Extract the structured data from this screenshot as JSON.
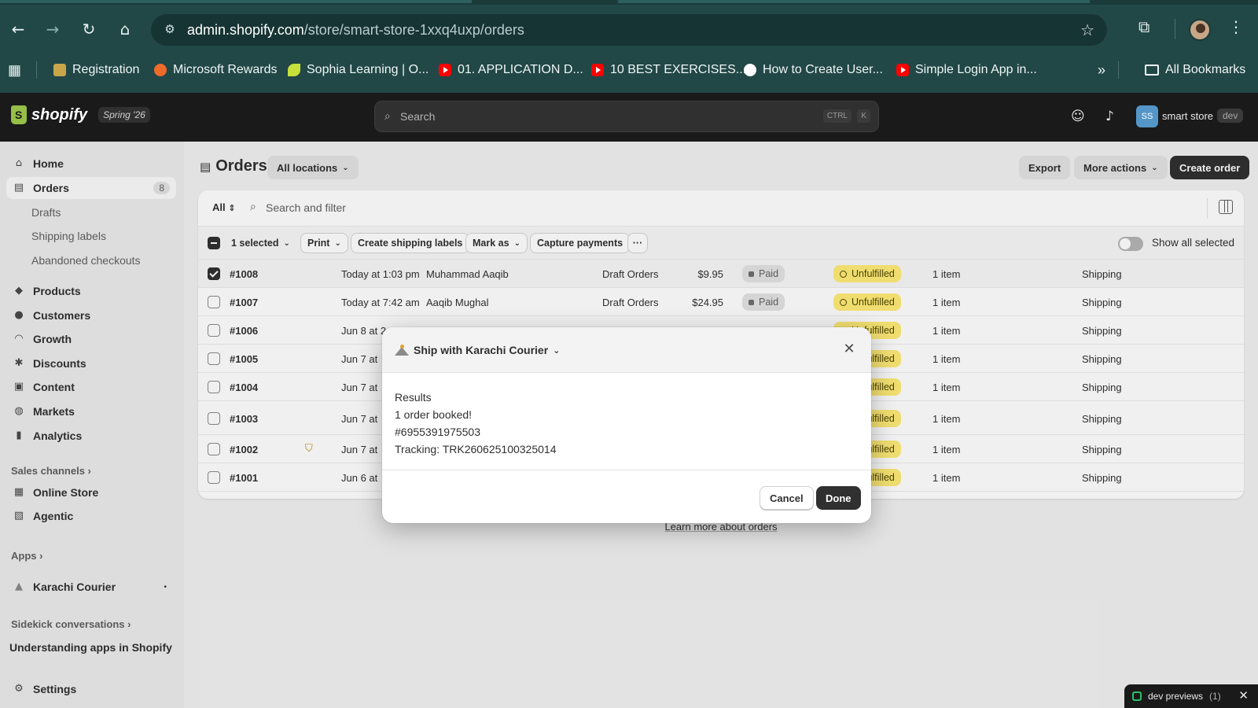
{
  "browser": {
    "url_host": "admin.shopify.com",
    "url_path": "/store/smart-store-1xxq4uxp/orders",
    "bookmarks": [
      {
        "label": "Registration",
        "icon": "registration-icon",
        "color": "#c9a64a"
      },
      {
        "label": "Microsoft Rewards",
        "icon": "rewards-icon",
        "color": "#f06a2a"
      },
      {
        "label": "Sophia Learning | O...",
        "icon": "sophia-icon",
        "color": "#c5e13a"
      },
      {
        "label": "01. APPLICATION D...",
        "icon": "youtube-icon",
        "color": "#ff0000"
      },
      {
        "label": "10 BEST EXERCISES...",
        "icon": "youtube-icon",
        "color": "#ff0000"
      },
      {
        "label": "How to Create User...",
        "icon": "medium-icon",
        "color": "#ffffff"
      },
      {
        "label": "Simple Login App in...",
        "icon": "youtube-icon",
        "color": "#ff0000"
      }
    ],
    "more_bookmarks": "»",
    "all_bookmarks": "All Bookmarks"
  },
  "topbar": {
    "brand": "shopify",
    "edition": "Spring '26",
    "search_placeholder": "Search",
    "shortcut_ctrl": "CTRL",
    "shortcut_k": "K",
    "store_initials": "SS",
    "store_name": "smart store",
    "env_badge": "dev"
  },
  "sidebar": {
    "home": "Home",
    "orders": "Orders",
    "orders_count": "8",
    "drafts": "Drafts",
    "shipping_labels": "Shipping labels",
    "abandoned_checkouts": "Abandoned checkouts",
    "products": "Products",
    "customers": "Customers",
    "growth": "Growth",
    "discounts": "Discounts",
    "content": "Content",
    "markets": "Markets",
    "analytics": "Analytics",
    "sales_channels": "Sales channels ›",
    "online_store": "Online Store",
    "agentic": "Agentic",
    "apps": "Apps ›",
    "karachi_courier": "Karachi Courier",
    "sidekick_conversations": "Sidekick conversations ›",
    "understanding_apps": "Understanding apps in Shopify",
    "settings": "Settings"
  },
  "page": {
    "title": "Orders",
    "locations": "All locations",
    "export": "Export",
    "more_actions": "More actions",
    "create_order": "Create order",
    "filter_all": "All",
    "search_filter": "Search and filter",
    "selected_count": "1 selected",
    "print": "Print",
    "create_shipping_labels": "Create shipping labels",
    "mark_as": "Mark as",
    "capture_payments": "Capture payments",
    "more": "···",
    "show_all_selected": "Show all selected",
    "learn_more": "Learn more about orders"
  },
  "orders": [
    {
      "id": "#1008",
      "date": "Today at 1:03 pm",
      "customer": "Muhammad Aaqib",
      "channel": "Draft Orders",
      "total": "$9.95",
      "payment": "Paid",
      "fulfillment": "Unfulfilled",
      "items": "1 item",
      "delivery": "Shipping",
      "checked": true
    },
    {
      "id": "#1007",
      "date": "Today at 7:42 am",
      "customer": "Aaqib Mughal",
      "channel": "Draft Orders",
      "total": "$24.95",
      "payment": "Paid",
      "fulfillment": "Unfulfilled",
      "items": "1 item",
      "delivery": "Shipping",
      "checked": false
    },
    {
      "id": "#1006",
      "date": "Jun 8 at 2",
      "customer": "",
      "channel": "",
      "total": "",
      "payment": "",
      "fulfillment": "Unfulfilled",
      "items": "1 item",
      "delivery": "Shipping",
      "checked": false
    },
    {
      "id": "#1005",
      "date": "Jun 7 at",
      "customer": "",
      "channel": "",
      "total": "",
      "payment": "",
      "fulfillment": "Unfulfilled",
      "items": "1 item",
      "delivery": "Shipping",
      "checked": false
    },
    {
      "id": "#1004",
      "date": "Jun 7 at",
      "customer": "",
      "channel": "",
      "total": "",
      "payment": "",
      "fulfillment": "Unfulfilled",
      "items": "1 item",
      "delivery": "Shipping",
      "checked": false
    },
    {
      "id": "#1003",
      "date": "Jun 7 at",
      "customer": "",
      "channel": "",
      "total": "",
      "payment": "",
      "fulfillment": "Unfulfilled",
      "items": "1 item",
      "delivery": "Shipping",
      "checked": false
    },
    {
      "id": "#1002",
      "date": "Jun 7 at",
      "customer": "",
      "channel": "",
      "total": "",
      "payment": "",
      "fulfillment": "Unfulfilled",
      "items": "1 item",
      "delivery": "Shipping",
      "checked": false
    },
    {
      "id": "#1001",
      "date": "Jun 6 at",
      "customer": "",
      "channel": "",
      "total": "",
      "payment": "",
      "fulfillment": "Unfulfilled",
      "items": "1 item",
      "delivery": "Shipping",
      "checked": false
    }
  ],
  "modal": {
    "title": "Ship with Karachi Courier",
    "results_label": "Results",
    "booked": "1 order booked!",
    "order_ref": "#6955391975503",
    "tracking": "Tracking: TRK260625100325014",
    "cancel": "Cancel",
    "done": "Done"
  },
  "dev_previews": {
    "label": "dev previews",
    "count": "(1)"
  },
  "colors": {
    "chrome": "#224747",
    "topbar": "#1a1a1a",
    "unfulfilled_badge": "#ffeb78",
    "primary_button": "#303030"
  }
}
